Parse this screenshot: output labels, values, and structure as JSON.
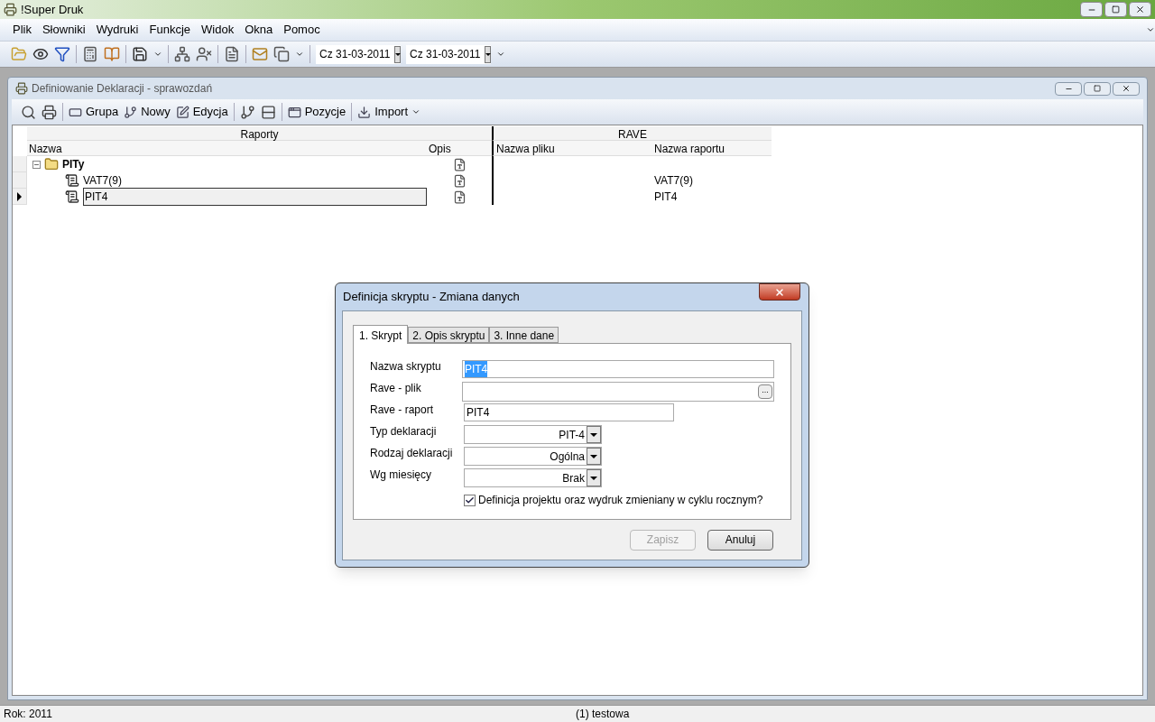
{
  "app": {
    "title": "!Super Druk"
  },
  "menu": [
    "Plik",
    "Słowniki",
    "Wydruki",
    "Funkcje",
    "Widok",
    "Okna",
    "Pomoc"
  ],
  "toolbar": {
    "dates": [
      "Cz 31-03-2011",
      "Cz 31-03-2011"
    ]
  },
  "child_window": {
    "title": "Definiowanie Deklaracji - sprawozdań",
    "toolbar": [
      {
        "kind": "icon"
      },
      {
        "kind": "icon"
      },
      {
        "kind": "sep"
      },
      {
        "kind": "button",
        "label": "Grupa"
      },
      {
        "kind": "button",
        "label": "Nowy"
      },
      {
        "kind": "button",
        "label": "Edycja"
      },
      {
        "kind": "sep"
      },
      {
        "kind": "icon"
      },
      {
        "kind": "icon"
      },
      {
        "kind": "sep"
      },
      {
        "kind": "button",
        "label": "Pozycje"
      },
      {
        "kind": "sep"
      },
      {
        "kind": "button",
        "label": "Import",
        "dropdown": true
      }
    ],
    "grid": {
      "groups": [
        "Raporty",
        "RAVE"
      ],
      "columns": [
        "Nazwa",
        "Opis",
        "Nazwa pliku",
        "Nazwa raportu"
      ],
      "rows": [
        {
          "name": "PITy",
          "kind": "folder",
          "expanded": true,
          "selected": false,
          "report": "",
          "children": [
            {
              "name": "VAT7(9)",
              "kind": "script",
              "selected": false,
              "report": "VAT7(9)"
            },
            {
              "name": "PIT4",
              "kind": "script",
              "selected": true,
              "report": "PIT4"
            }
          ]
        }
      ]
    }
  },
  "dialog": {
    "title": "Definicja skryptu - Zmiana danych",
    "tabs": [
      {
        "label": "1. Skrypt",
        "selected": true
      },
      {
        "label": "2. Opis skryptu",
        "selected": false
      },
      {
        "label": "3. Inne dane",
        "selected": false
      }
    ],
    "fields": [
      {
        "kind": "text",
        "label": "Nazwa skryptu",
        "value": "PIT4",
        "highlighted": true,
        "wide": true
      },
      {
        "kind": "browse",
        "label": "Rave - plik",
        "button": "..."
      },
      {
        "kind": "text",
        "label": "Rave - raport",
        "value": "PIT4",
        "highlighted": false,
        "wide": false
      },
      {
        "kind": "select",
        "label": "Typ deklaracji",
        "value": "PIT-4"
      },
      {
        "kind": "select",
        "label": "Rodzaj deklaracji",
        "value": "Ogólna"
      },
      {
        "kind": "select",
        "label": "Wg miesięcy",
        "value": "Brak"
      }
    ],
    "checkbox": {
      "label": "Definicja projektu oraz wydruk zmieniany w cyklu rocznym?",
      "checked": true
    },
    "buttons": [
      {
        "label": "Zapisz",
        "disabled": true
      },
      {
        "label": "Anuluj",
        "disabled": false
      }
    ]
  },
  "status_bar": [
    "Rok: 2011",
    "(1) testowa"
  ]
}
